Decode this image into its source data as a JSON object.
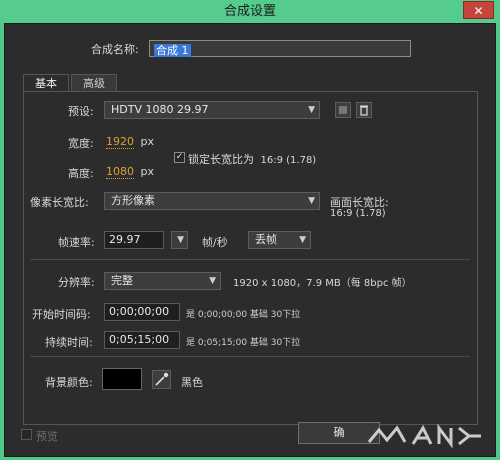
{
  "window": {
    "title": "合成设置",
    "close_symbol": "✕"
  },
  "composition_name": {
    "label": "合成名称:",
    "value": "合成 1"
  },
  "tabs": [
    {
      "label": "基本"
    },
    {
      "label": "高级"
    }
  ],
  "preset": {
    "label": "预设:",
    "value": "HDTV 1080 29.97"
  },
  "width": {
    "label": "宽度:",
    "value": "1920",
    "unit": "px"
  },
  "height": {
    "label": "高度:",
    "value": "1080",
    "unit": "px"
  },
  "lock_aspect": {
    "label": "锁定长宽比为",
    "ratio": "16:9 (1.78)",
    "checked": true,
    "check_symbol": "✓"
  },
  "pixel_aspect": {
    "label": "像素长宽比:",
    "value": "方形像素"
  },
  "frame_aspect": {
    "label": "画面长宽比:",
    "value": "16:9 (1.78)"
  },
  "frame_rate": {
    "label": "帧速率:",
    "value": "29.97",
    "unit": "帧/秒",
    "drop_frame": "丢帧"
  },
  "resolution": {
    "label": "分辨率:",
    "value": "完整",
    "info": "1920 x 1080，7.9 MB（每 8bpc 帧）"
  },
  "start_timecode": {
    "label": "开始时间码:",
    "value": "0;00;00;00",
    "info": "是 0;00;00;00  基础 30下拉"
  },
  "duration": {
    "label": "持续时间:",
    "value": "0;05;15;00",
    "info": "是 0;05;15;00  基础 30下拉"
  },
  "background": {
    "label": "背景颜色:",
    "color_name": "黑色",
    "color": "#000000"
  },
  "preview": {
    "label": "预览"
  },
  "ok_button": {
    "label": "确"
  }
}
